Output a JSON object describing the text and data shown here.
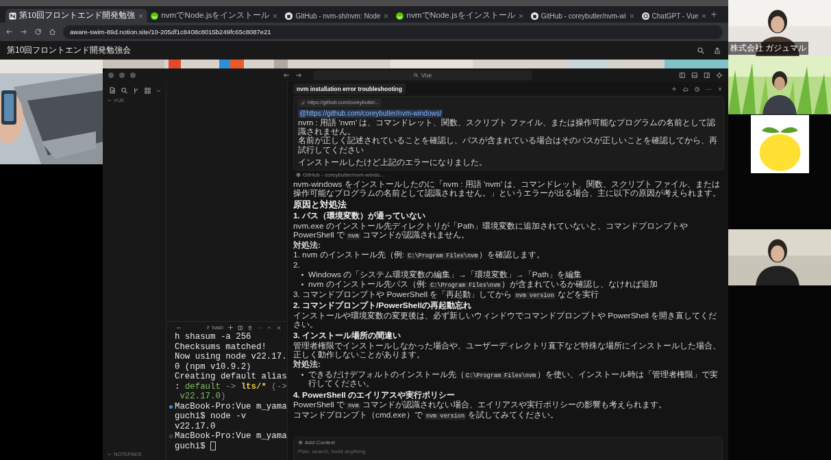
{
  "browser": {
    "tabs": [
      {
        "title": "第10回フロントエンド開発勉強",
        "kind": "notion",
        "selected": true
      },
      {
        "title": "nvmでNode.jsをインストール",
        "kind": "article",
        "selected": false
      },
      {
        "title": "GitHub - nvm-sh/nvm: Node",
        "kind": "github",
        "selected": false
      },
      {
        "title": "nvmでNode.jsをインストール",
        "kind": "article",
        "selected": false
      },
      {
        "title": "GitHub - coreybutler/nvm-wi",
        "kind": "github",
        "selected": false
      },
      {
        "title": "ChatGPT - Vue",
        "kind": "chatgpt",
        "selected": false
      }
    ],
    "address": "aware-swim-89d.notion.site/10-205df1c8408c8015b249fc65c8087e21",
    "page_title": "第10回フロントエンド開発勉強会"
  },
  "editor": {
    "search": "Vue",
    "explorer_section": "VUE",
    "notepads_section": "NOTEPADS",
    "terminal": {
      "shell": "bash",
      "lines": [
        {
          "parts": [
            {
              "text": "h shasum -a 256",
              "kind": "plain"
            }
          ]
        },
        {
          "parts": [
            {
              "text": "Checksums matched!",
              "kind": "plain"
            }
          ]
        },
        {
          "parts": [
            {
              "text": "Now using node v22.17.",
              "kind": "plain"
            }
          ]
        },
        {
          "parts": [
            {
              "text": "0 (npm v10.9.2)",
              "kind": "plain"
            }
          ]
        },
        {
          "parts": [
            {
              "text": "Creating default alias",
              "kind": "plain"
            }
          ]
        },
        {
          "parts": [
            {
              "text": ": ",
              "kind": "plain"
            },
            {
              "text": "default",
              "kind": "green"
            },
            {
              "text": " -> ",
              "kind": "dim"
            },
            {
              "text": "lts/*",
              "kind": "yellow"
            },
            {
              "text": " (->",
              "kind": "dim"
            }
          ]
        },
        {
          "parts": [
            {
              "text": " v22.17.0",
              "kind": "green"
            },
            {
              "text": ")",
              "kind": "dim"
            }
          ]
        },
        {
          "parts": [
            {
              "text": "MacBook-Pro:Vue m_yama",
              "kind": "plain"
            }
          ],
          "kind": "success"
        },
        {
          "parts": [
            {
              "text": "guchi$ node -v",
              "kind": "plain"
            }
          ]
        },
        {
          "parts": [
            {
              "text": "v22.17.0",
              "kind": "plain"
            }
          ]
        },
        {
          "parts": [
            {
              "text": "MacBook-Pro:Vue m_yama",
              "kind": "plain"
            }
          ],
          "kind": "pending"
        },
        {
          "parts": [
            {
              "text": "guchi$ ",
              "kind": "plain"
            }
          ],
          "cursor": true
        }
      ]
    }
  },
  "chat": {
    "title": "nvm installation error troubleshooting",
    "user_message": {
      "chip": "https://github.com/coreybutler...",
      "mention": "@https://github.com/coreybutler/nvm-windows/",
      "paragraphs": [
        [
          "nvm : 用語 'nvm' は、コマンドレット、関数、スクリプト ファイル、または操作可能なプログラムの名前として認識されません。",
          "名前が正しく記述されていることを確認し、パスが含まれている場合はそのパスが正しいことを確認してから、再試行してください"
        ],
        [
          "インストールしたけど上記のエラーになりました。"
        ]
      ]
    },
    "source_chip": "GitHub - coreybutler/nvm-windo...",
    "blocks": [
      {
        "kind": "p",
        "text": "nvm-windows をインストールしたのに「nvm : 用語 'nvm' は、コマンドレット、関数、スクリプト ファイル、または操作可能なプログラムの名前として認識されません。」というエラーが出る場合、主に以下の原因が考えられます。"
      },
      {
        "kind": "h3",
        "text": "原因と対処法"
      },
      {
        "kind": "h4",
        "text": "1. パス（環境変数）が通っていない"
      },
      {
        "kind": "p",
        "parts": [
          {
            "text": "nvm.exe のインストール先ディレクトリが「Path」環境変数に追加されていないと、コマンドプロンプトや PowerShell で ",
            "code": false
          },
          {
            "text": "nvm",
            "code": true
          },
          {
            "text": " コマンドが認識されません。",
            "code": false
          }
        ]
      },
      {
        "kind": "label",
        "text": "対処法:"
      },
      {
        "kind": "item",
        "parts": [
          {
            "text": "1. nvm のインストール先（例: ",
            "code": false
          },
          {
            "text": "C:\\Program Files\\nvm",
            "code": true
          },
          {
            "text": "）を確認します。",
            "code": false
          }
        ]
      },
      {
        "kind": "item",
        "text": "2."
      },
      {
        "kind": "bullet",
        "text": "Windows の「システム環境変数の編集」→「環境変数」→「Path」を編集"
      },
      {
        "kind": "bullet",
        "parts": [
          {
            "text": "nvm のインストール先パス（例: ",
            "code": false
          },
          {
            "text": "C:\\Program Files\\nvm",
            "code": true
          },
          {
            "text": "）が含まれているか確認し、なければ追加",
            "code": false
          }
        ]
      },
      {
        "kind": "item",
        "parts": [
          {
            "text": "3. コマンドプロンプトや PowerShell を「再起動」してから ",
            "code": false
          },
          {
            "text": "nvm version",
            "code": true
          },
          {
            "text": " などを実行",
            "code": false
          }
        ]
      },
      {
        "kind": "h4",
        "text": "2. コマンドプロンプト/PowerShellの再起動忘れ"
      },
      {
        "kind": "p",
        "text": "インストールや環境変数の変更後は、必ず新しいウィンドウでコマンドプロンプトや PowerShell を開き直してください。"
      },
      {
        "kind": "h4",
        "text": "3. インストール場所の間違い"
      },
      {
        "kind": "p",
        "text": "管理者権限でインストールしなかった場合や、ユーザーディレクトリ直下など特殊な場所にインストールした場合、正しく動作しないことがあります。"
      },
      {
        "kind": "label",
        "text": "対処法:"
      },
      {
        "kind": "bullet",
        "parts": [
          {
            "text": "できるだけデフォルトのインストール先（",
            "code": false
          },
          {
            "text": "C:\\Program Files\\nvm",
            "code": true
          },
          {
            "text": "）を使い、インストール時は「管理者権限」で実行してください。",
            "code": false
          }
        ]
      },
      {
        "kind": "h4",
        "text": "4. PowerShell のエイリアスや実行ポリシー"
      },
      {
        "kind": "p",
        "parts": [
          {
            "text": "PowerShell で ",
            "code": false
          },
          {
            "text": "nvm",
            "code": true
          },
          {
            "text": " コマンドが認識されない場合、エイリアスや実行ポリシーの影響も考えられます。",
            "code": false
          }
        ]
      },
      {
        "kind": "p",
        "parts": [
          {
            "text": "コマンドプロンプト（cmd.exe）で ",
            "code": false
          },
          {
            "text": "nvm version",
            "code": true
          },
          {
            "text": " を試してみてください。",
            "code": false
          }
        ]
      }
    ],
    "input": {
      "context_button": "Add Context",
      "placeholder": "Plan, search, build anything"
    }
  },
  "participants": [
    {
      "kind": "camera",
      "name": "株式会社 ガジュマル"
    },
    {
      "kind": "camera"
    },
    {
      "kind": "avatar"
    },
    {
      "kind": "off"
    },
    {
      "kind": "camera"
    }
  ]
}
